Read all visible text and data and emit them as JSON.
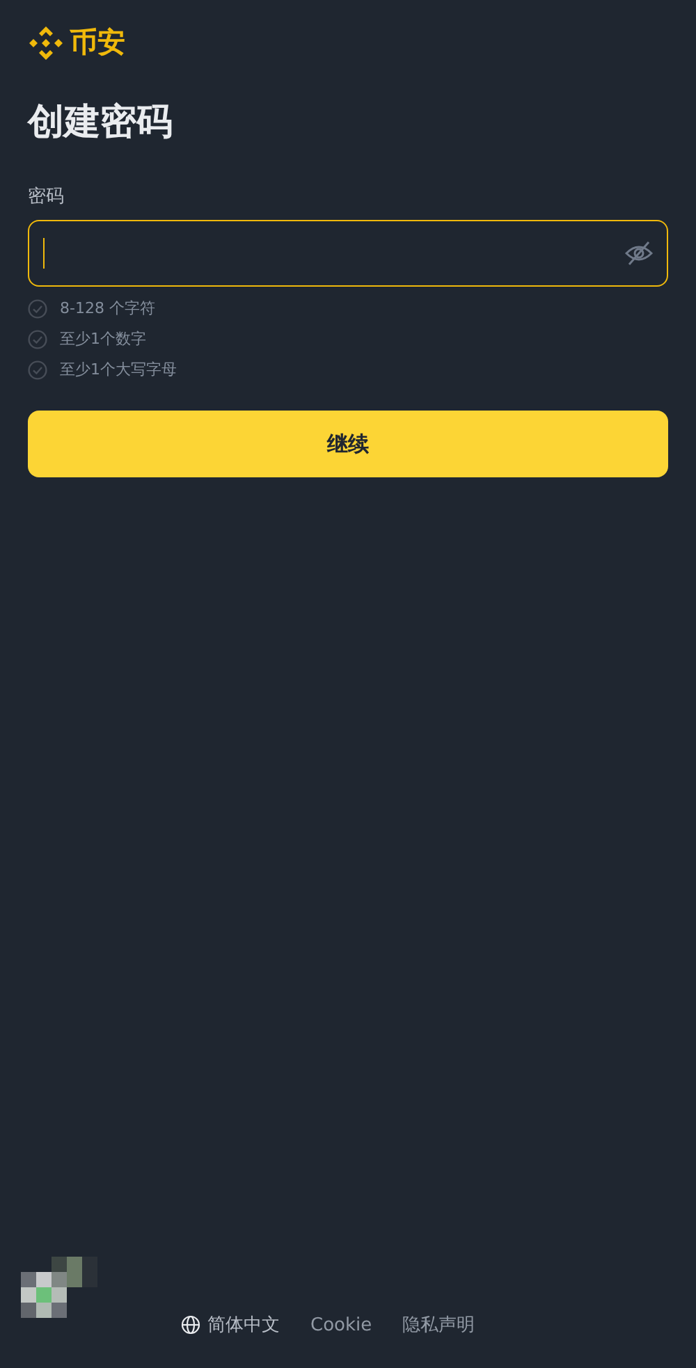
{
  "logo": {
    "text": "币安"
  },
  "title": "创建密码",
  "password_field": {
    "label": "密码",
    "focused": true
  },
  "rules": [
    {
      "text": "8-128 个字符",
      "met": false
    },
    {
      "text": "至少1个数字",
      "met": false
    },
    {
      "text": "至少1个大写字母",
      "met": false
    }
  ],
  "continue_button": "继续",
  "footer": {
    "language": "简体中文",
    "links": [
      "Cookie",
      "隐私声明"
    ]
  }
}
